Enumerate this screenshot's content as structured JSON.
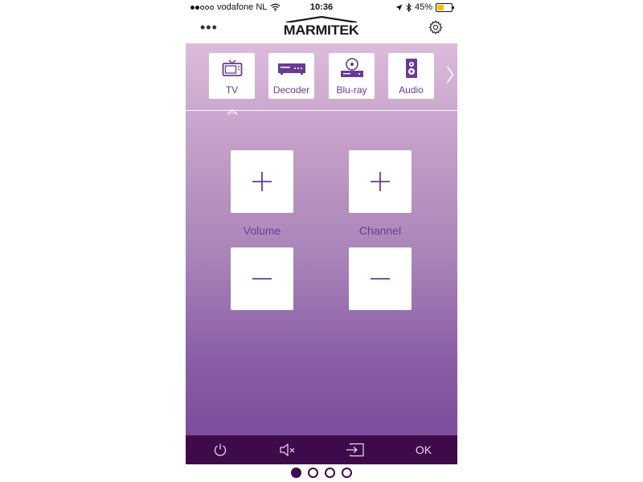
{
  "status_bar": {
    "carrier": "vodafone NL",
    "time": "10:36",
    "battery_percent": "45%",
    "battery_level": 0.45,
    "signal_filled": 2,
    "signal_total": 5
  },
  "header": {
    "logo_text": "MARMITEK",
    "menu_icon": "more-dots-icon",
    "settings_icon": "gear-icon"
  },
  "devices": [
    {
      "label": "TV",
      "icon": "tv-icon",
      "selected": true
    },
    {
      "label": "Decoder",
      "icon": "decoder-icon",
      "selected": false
    },
    {
      "label": "Blu-ray",
      "icon": "bluray-icon",
      "selected": false
    },
    {
      "label": "Audio",
      "icon": "speaker-icon",
      "selected": false
    }
  ],
  "controls": {
    "volume_label": "Volume",
    "channel_label": "Channel"
  },
  "bottom_bar": {
    "power_icon": "power-icon",
    "mute_icon": "mute-icon",
    "input_icon": "input-icon",
    "ok_label": "OK"
  },
  "pager": {
    "count": 4,
    "active_index": 0
  },
  "colors": {
    "accent": "#6a3b93",
    "bar_bg": "#3f0a4a",
    "battery": "#f2c200"
  }
}
